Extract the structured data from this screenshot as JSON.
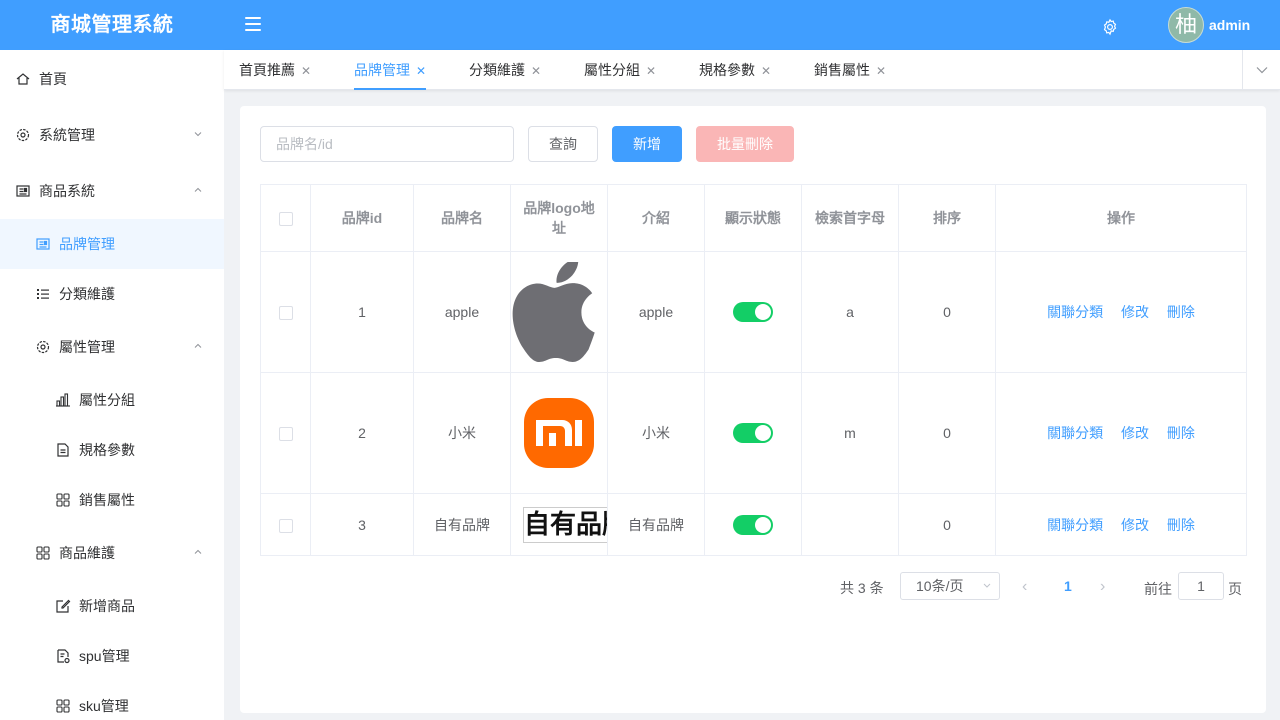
{
  "header": {
    "brand": "商城管理系統",
    "avatar_char": "柚",
    "username": "admin"
  },
  "sidebar": {
    "items": [
      {
        "label": "首頁",
        "icon": "home-icon"
      },
      {
        "label": "系統管理",
        "icon": "gear-icon",
        "arrow": "down"
      },
      {
        "label": "商品系統",
        "icon": "goods-icon",
        "arrow": "up"
      },
      {
        "label": "品牌管理",
        "icon": "brand-icon",
        "active": true
      },
      {
        "label": "分類維護",
        "icon": "list-icon"
      },
      {
        "label": "屬性管理",
        "icon": "gear-icon",
        "arrow": "up"
      },
      {
        "label": "屬性分組",
        "icon": "bar-chart-icon"
      },
      {
        "label": "規格參數",
        "icon": "document-icon"
      },
      {
        "label": "銷售屬性",
        "icon": "grid-icon"
      },
      {
        "label": "商品維護",
        "icon": "grid-icon",
        "arrow": "up"
      },
      {
        "label": "新增商品",
        "icon": "edit-icon"
      },
      {
        "label": "spu管理",
        "icon": "doc-gear-icon"
      },
      {
        "label": "sku管理",
        "icon": "grid-icon"
      }
    ]
  },
  "tabs": [
    {
      "label": "首頁推薦"
    },
    {
      "label": "品牌管理",
      "active": true
    },
    {
      "label": "分類維護"
    },
    {
      "label": "屬性分組"
    },
    {
      "label": "規格參數"
    },
    {
      "label": "銷售屬性"
    }
  ],
  "toolbar": {
    "search_placeholder": "品牌名/id",
    "query_label": "查詢",
    "add_label": "新增",
    "batch_delete_label": "批量刪除"
  },
  "table": {
    "headers": [
      "品牌id",
      "品牌名",
      "品牌logo地址",
      "介紹",
      "顯示狀態",
      "檢索首字母",
      "排序",
      "操作"
    ],
    "rows": [
      {
        "id": "1",
        "name": "apple",
        "logo": "apple",
        "intro": "apple",
        "status": true,
        "first_letter": "a",
        "sort": "0"
      },
      {
        "id": "2",
        "name": "小米",
        "logo": "mi",
        "intro": "小米",
        "status": true,
        "first_letter": "m",
        "sort": "0"
      },
      {
        "id": "3",
        "name": "自有品牌",
        "logo_text": "自有品牌",
        "intro": "自有品牌",
        "status": true,
        "first_letter": "",
        "sort": "0"
      }
    ],
    "actions": {
      "link": "關聯分類",
      "edit": "修改",
      "delete": "刪除"
    }
  },
  "pagination": {
    "total": "共 3 条",
    "page_size": "10条/页",
    "current": "1",
    "goto_label": "前往",
    "goto_value": "1",
    "page_suffix": "页"
  },
  "colors": {
    "primary": "#409eff",
    "switch_on": "#13ce66",
    "danger_disabled": "#fab6b6",
    "mi_orange": "#ff6900"
  }
}
